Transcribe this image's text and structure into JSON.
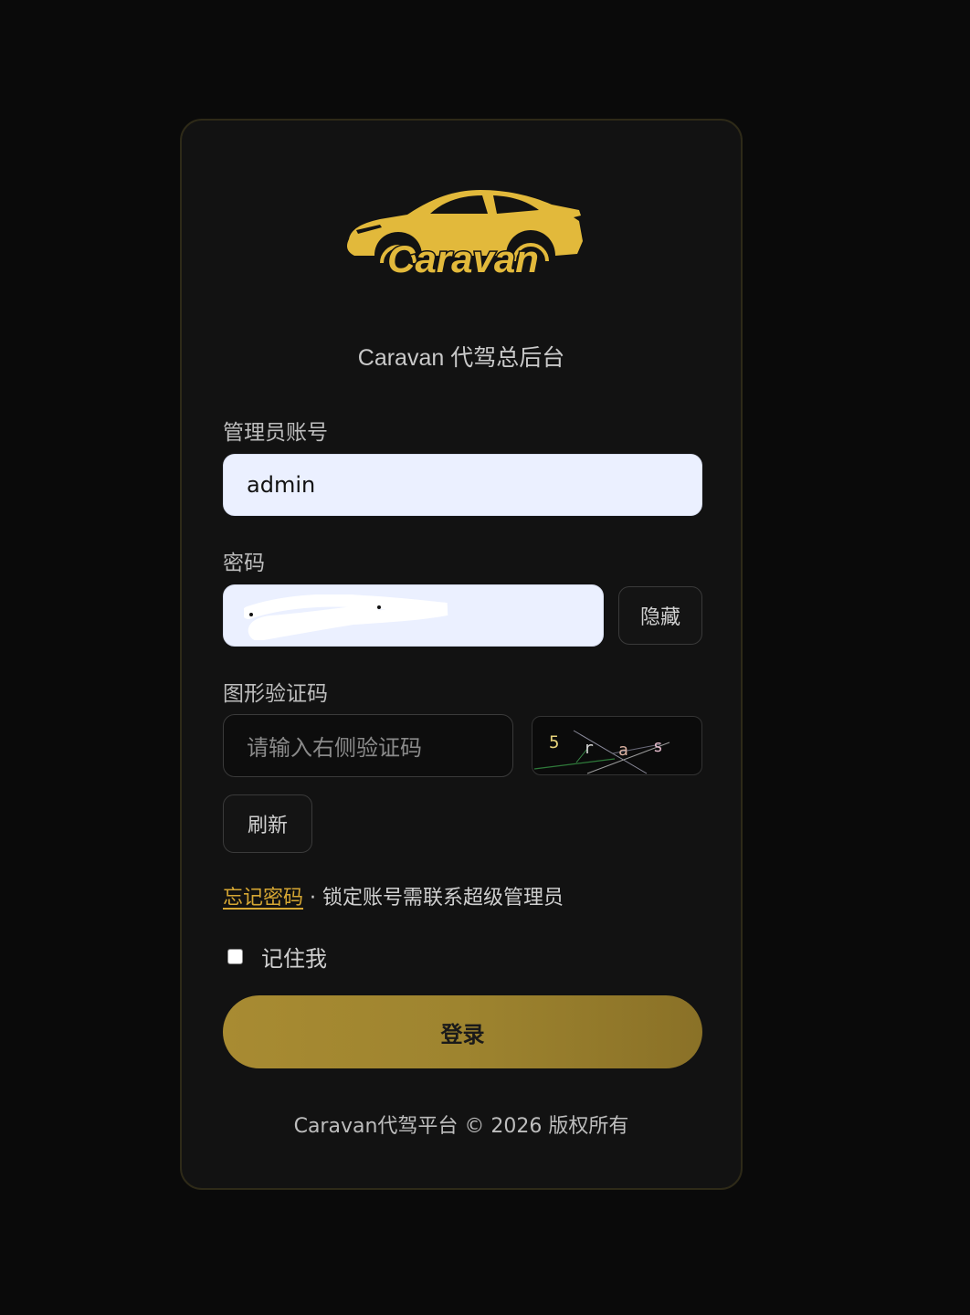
{
  "brand": {
    "logo_text": "Caravan",
    "logo_color": "#e2b93b"
  },
  "subtitle": "Caravan 代驾总后台",
  "account": {
    "label": "管理员账号",
    "value": "admin"
  },
  "password": {
    "label": "密码",
    "toggle_label": "隐藏"
  },
  "captcha": {
    "label": "图形验证码",
    "placeholder": "请输入右侧验证码",
    "image_chars": [
      "5",
      "r",
      "a",
      "s"
    ],
    "refresh_label": "刷新"
  },
  "forgot": {
    "link_label": "忘记密码",
    "separator": " · ",
    "note": "锁定账号需联系超级管理员"
  },
  "remember": {
    "label": "记住我",
    "checked": false
  },
  "login_button_label": "登录",
  "footer_text": "Caravan代驾平台 © 2026 版权所有",
  "colors": {
    "accent": "#d6a733",
    "button_gold": "#a88b32",
    "background": "#0a0a0a"
  }
}
